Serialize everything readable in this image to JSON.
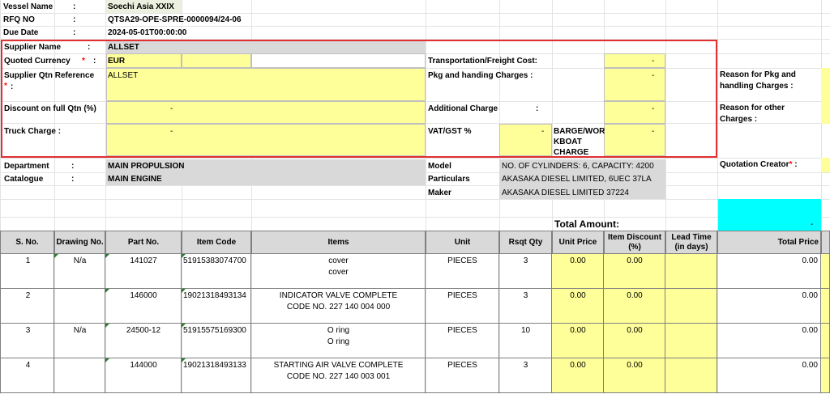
{
  "header": {
    "vessel_label": "Vessel Name",
    "vessel_value": "Soechi Asia XXIX",
    "rfq_label": "RFQ NO",
    "rfq_value": "QTSA29-OPE-SPRE-0000094/24-06",
    "due_label": "Due Date",
    "due_value": "2024-05-01T00:00:00",
    "colon": ":"
  },
  "supplier": {
    "name_label": "Supplier Name",
    "name_value": "ALLSET",
    "currency_label": "Quoted Currency",
    "currency_value": "EUR",
    "qtn_ref_label": "Supplier Qtn Reference",
    "qtn_ref_value": "ALLSET",
    "discount_label": "Discount on full Qtn  (%)",
    "discount_value": "-",
    "truck_label": "Truck Charge :",
    "truck_value": "-",
    "required_mark": "*"
  },
  "charges": {
    "transport_label": "Transportation/Freight Cost:",
    "transport_value": "-",
    "pkg_label": "Pkg and handing Charges  :",
    "pkg_value": "-",
    "additional_label": "Additional Charge",
    "additional_value": "-",
    "vat_label": "VAT/GST %",
    "vat_value": "-",
    "barge_label_1": "BARGE/WOR",
    "barge_label_2": "KBOAT",
    "barge_label_3": "CHARGE",
    "barge_value": "-"
  },
  "reasons": {
    "pkg_reason_1": "Reason for Pkg and",
    "pkg_reason_2": "handling Charges :",
    "other_reason_1": "Reason for other",
    "other_reason_2": "Charges :",
    "creator_label": "Quotation Creator",
    "creator_suffix": " :"
  },
  "equipment": {
    "department_label": "Department",
    "department_value": "MAIN PROPULSION",
    "catalogue_label": "Catalogue",
    "catalogue_value": "MAIN ENGINE",
    "model_label": "Model",
    "model_value": "NO. OF CYLINDERS: 6, CAPACITY: 4200",
    "particulars_label": "Particulars",
    "particulars_value": "AKASAKA DIESEL LIMITED, 6UEC 37LA",
    "maker_label": "Maker",
    "maker_value": "AKASAKA DIESEL LIMITED     37224"
  },
  "totals": {
    "label": "Total Amount:",
    "value": "-"
  },
  "table": {
    "headers": {
      "sno": "S. No.",
      "drawing": "Drawing No.",
      "part": "Part No.",
      "item_code": "Item Code",
      "items": "Items",
      "unit": "Unit",
      "qty": "Rsqt Qty",
      "price": "Unit Price",
      "discount_1": "Item Discount",
      "discount_2": "(%)",
      "lead_1": "Lead Time",
      "lead_2": "(in days)",
      "total": "Total Price"
    },
    "rows": [
      {
        "sno": "1",
        "drawing": "N/a",
        "part": "141027",
        "code": "51915383074700",
        "item_1": "cover",
        "item_2": "cover",
        "unit": "PIECES",
        "qty": "3",
        "price": "0.00",
        "discount": "0.00",
        "total": "0.00"
      },
      {
        "sno": "2",
        "drawing": "",
        "part": "146000",
        "code": "19021318493134",
        "item_1": "INDICATOR VALVE COMPLETE",
        "item_2": "CODE NO. 227 140 004 000",
        "unit": "PIECES",
        "qty": "3",
        "price": "0.00",
        "discount": "0.00",
        "total": "0.00"
      },
      {
        "sno": "3",
        "drawing": "N/a",
        "part": "24500-12",
        "code": "51915575169300",
        "item_1": "O ring",
        "item_2": "O ring",
        "unit": "PIECES",
        "qty": "10",
        "price": "0.00",
        "discount": "0.00",
        "total": "0.00"
      },
      {
        "sno": "4",
        "drawing": "",
        "part": "144000",
        "code": "19021318493133",
        "item_1": "STARTING AIR VALVE COMPLETE",
        "item_2": "CODE NO. 227 140 003 001",
        "unit": "PIECES",
        "qty": "3",
        "price": "0.00",
        "discount": "0.00",
        "total": "0.00"
      }
    ]
  }
}
